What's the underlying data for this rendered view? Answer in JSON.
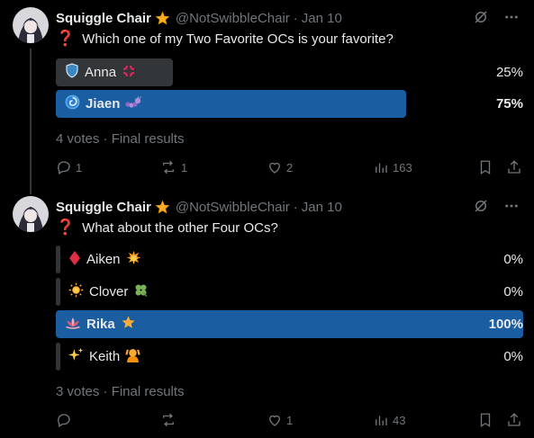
{
  "posts": [
    {
      "author": {
        "name": "Squiggle Chair",
        "handle": "@NotSwibbleChair",
        "date": "Jan 10"
      },
      "question": "Which one of my Two Favorite OCs is your favorite?",
      "options": [
        {
          "label": "Anna",
          "percent": "25%",
          "fraction": 0.25,
          "winner": false
        },
        {
          "label": "Jiaen",
          "percent": "75%",
          "fraction": 0.75,
          "winner": true
        }
      ],
      "meta": "4 votes · Final results",
      "actions": {
        "replies": "1",
        "reposts": "1",
        "likes": "2",
        "views": "163"
      }
    },
    {
      "author": {
        "name": "Squiggle Chair",
        "handle": "@NotSwibbleChair",
        "date": "Jan 10"
      },
      "question": "What about the other Four OCs?",
      "options": [
        {
          "label": "Aiken",
          "percent": "0%",
          "fraction": 0,
          "winner": false
        },
        {
          "label": "Clover",
          "percent": "0%",
          "fraction": 0,
          "winner": false
        },
        {
          "label": "Rika",
          "percent": "100%",
          "fraction": 1,
          "winner": true
        },
        {
          "label": "Keith",
          "percent": "0%",
          "fraction": 0,
          "winner": false
        }
      ],
      "meta": "3 votes · Final results",
      "actions": {
        "replies": "",
        "reposts": "",
        "likes": "1",
        "views": "43"
      }
    }
  ],
  "colors": {
    "winner_bar": "#1a5da0",
    "loser_bar": "#333639",
    "muted": "#71767b",
    "verified": "#ffad1f"
  }
}
